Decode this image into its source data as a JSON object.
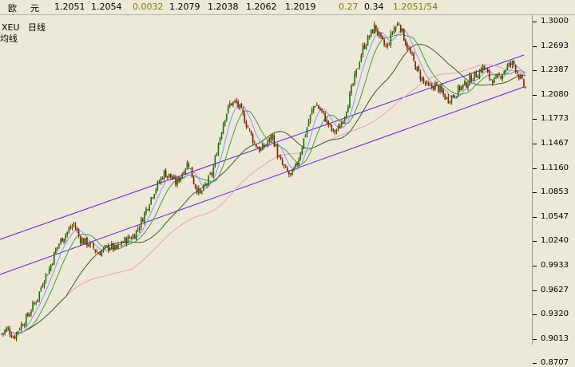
{
  "quote_bar": {
    "name_char1": "欧",
    "name_char2": "元",
    "bid": "1.2051",
    "ask": "1.2054",
    "change": "0.0032",
    "high": "1.2079",
    "low": "1.2038",
    "open": "1.2062",
    "prev": "1.2019",
    "pct": "0.27",
    "range": "0.34",
    "last": "1.2051/54",
    "colors": {
      "text": "#000000",
      "change": "#808000",
      "pct": "#808000",
      "last": "#808000"
    }
  },
  "chart": {
    "symbol": "XEU",
    "period": "日线",
    "indicator": "均线",
    "price_ticks": [
      "1.3000",
      "1.2693",
      "1.2387",
      "1.2080",
      "1.1773",
      "1.1467",
      "1.1160",
      "1.0853",
      "1.0547",
      "1.0240",
      "0.9933",
      "0.9627",
      "0.9320",
      "0.9013",
      "0.8707"
    ],
    "colors": {
      "background": "#ECE9D8",
      "candle": "#8B1A00",
      "candle_up": "#008000",
      "ma_fast": "#9090FF",
      "ma_mid": "#40A040",
      "ma_slow": "#406020",
      "ma_long": "#E8A0C0",
      "channel": "#6020E0"
    },
    "icons": {
      "cursor": "crosshair"
    }
  },
  "chart_data": {
    "type": "line",
    "title": "",
    "ylim": [
      0.8555,
      1.305
    ],
    "series": [
      {
        "values": [
          0.87,
          0.878,
          0.865,
          0.88,
          0.89,
          0.905,
          0.92,
          0.945,
          0.96,
          0.985,
          1.0,
          1.01,
          1.02,
          1.0,
          0.995,
          0.99,
          0.98,
          0.985,
          0.99,
          0.985,
          0.995,
          1.0,
          1.005,
          1.02,
          1.04,
          1.06,
          1.075,
          1.09,
          1.085,
          1.075,
          1.09,
          1.105,
          1.075,
          1.06,
          1.075,
          1.09,
          1.13,
          1.165,
          1.185,
          1.185,
          1.17,
          1.15,
          1.13,
          1.12,
          1.13,
          1.14,
          1.11,
          1.095,
          1.085,
          1.1,
          1.13,
          1.16,
          1.185,
          1.175,
          1.16,
          1.145,
          1.15,
          1.17,
          1.2,
          1.23,
          1.26,
          1.275,
          1.29,
          1.27,
          1.26,
          1.285,
          1.295,
          1.27,
          1.25,
          1.23,
          1.215,
          1.205,
          1.21,
          1.2,
          1.19,
          1.195,
          1.205,
          1.21,
          1.22,
          1.225,
          1.235,
          1.22,
          1.215,
          1.225,
          1.235,
          1.24,
          1.22,
          1.205
        ]
      }
    ]
  }
}
